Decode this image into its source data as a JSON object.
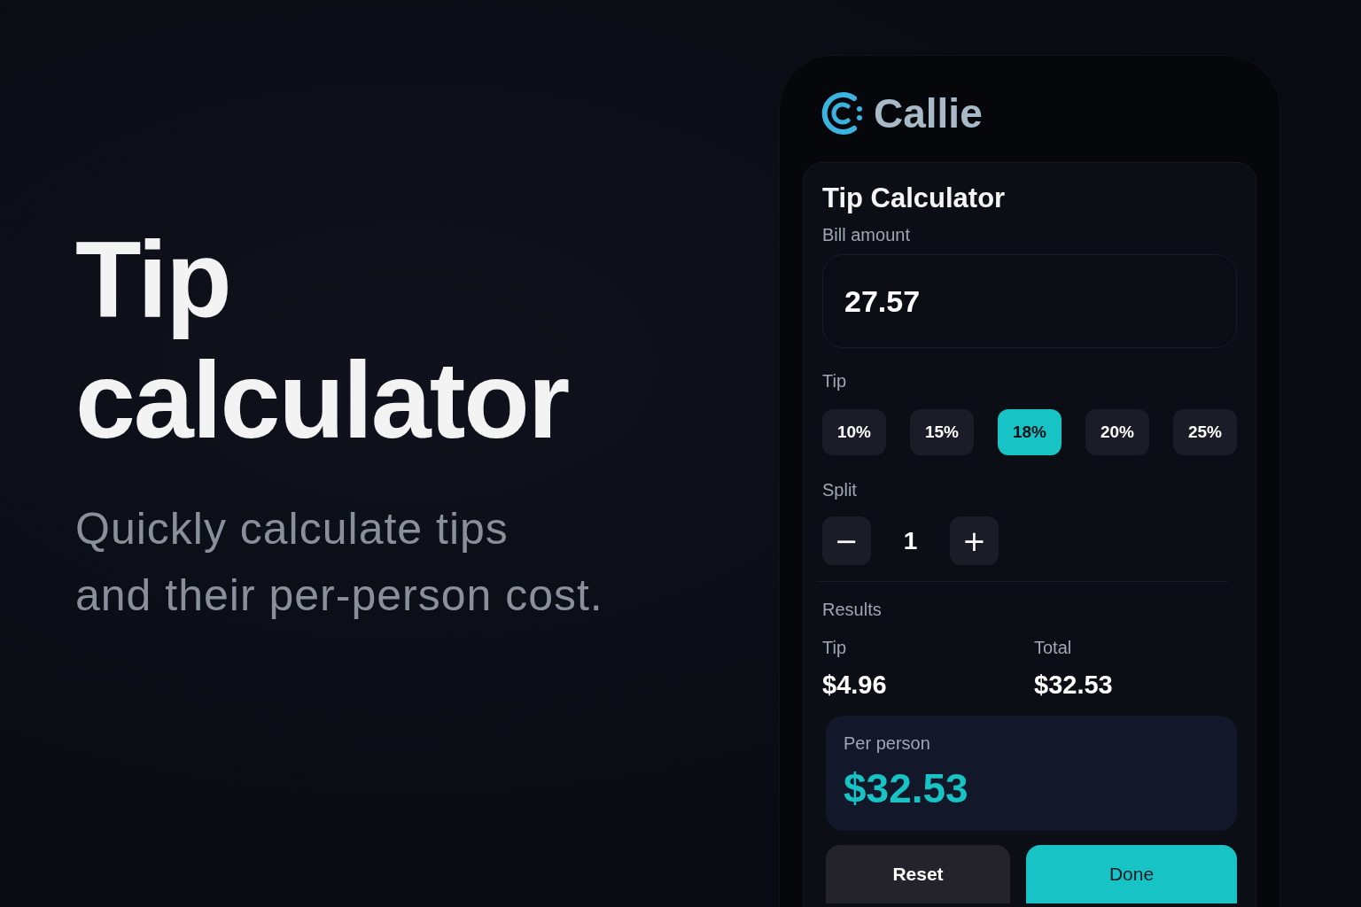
{
  "hero": {
    "title_lines": [
      "Tip",
      "calculator"
    ],
    "subtitle_lines": [
      "Quickly calculate tips",
      "and their per-person cost."
    ]
  },
  "app": {
    "brand": "Callie",
    "card": {
      "title": "Tip Calculator",
      "bill": {
        "label": "Bill amount",
        "value": "27.57"
      },
      "tip": {
        "label": "Tip",
        "options": [
          {
            "label": "10%",
            "selected": false
          },
          {
            "label": "15%",
            "selected": false
          },
          {
            "label": "18%",
            "selected": true
          },
          {
            "label": "20%",
            "selected": false
          },
          {
            "label": "25%",
            "selected": false
          }
        ]
      },
      "split": {
        "label": "Split",
        "decrement": "−",
        "value": "1",
        "increment": "+"
      },
      "results": {
        "heading": "Results",
        "items": [
          {
            "label": "Tip",
            "value": "$4.96"
          },
          {
            "label": "Total",
            "value": "$32.53"
          }
        ],
        "per_person": {
          "label": "Per person",
          "value": "$32.53"
        }
      },
      "actions": [
        {
          "label": "Reset",
          "kind": "secondary"
        },
        {
          "label": "Done",
          "kind": "primary"
        }
      ]
    }
  }
}
